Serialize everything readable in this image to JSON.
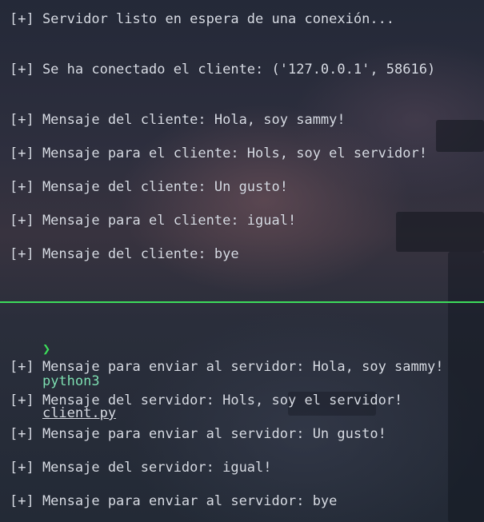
{
  "server_pane": {
    "lines": [
      "[+] Servidor listo en espera de una conexión...",
      "[+] Se ha conectado el cliente: ('127.0.0.1', 58616)",
      "[+] Mensaje del cliente: Hola, soy sammy!",
      "[+] Mensaje para el cliente: Hols, soy el servidor!",
      "[+] Mensaje del cliente: Un gusto!",
      "[+] Mensaje para el cliente: igual!",
      "[+] Mensaje del cliente: bye"
    ]
  },
  "client_pane": {
    "prompt": {
      "symbol": "❯",
      "command": "python3",
      "argument": "client.py"
    },
    "lines": [
      "[+] Mensaje para enviar al servidor: Hola, soy sammy!",
      "[+] Mensaje del servidor: Hols, soy el servidor!",
      "[+] Mensaje para enviar al servidor: Un gusto!",
      "[+] Mensaje del servidor: igual!",
      "[+] Mensaje para enviar al servidor: bye"
    ]
  },
  "colors": {
    "text": "#d9dde6",
    "divider": "#3ddc5b",
    "prompt_symbol": "#3ddc5b",
    "prompt_command": "#7fe0b4"
  }
}
